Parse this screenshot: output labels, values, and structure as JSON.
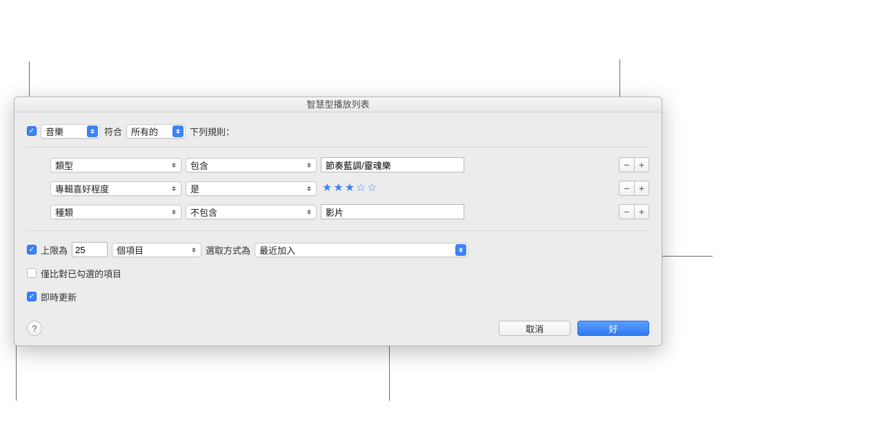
{
  "title": "智慧型播放列表",
  "match": {
    "media_label": "音樂",
    "conform_label": "符合",
    "quantifier": "所有的",
    "suffix": "下列規則："
  },
  "rules": [
    {
      "attribute": "類型",
      "operator": "包含",
      "value": "節奏藍調/靈魂樂",
      "input_type": "text"
    },
    {
      "attribute": "專輯喜好程度",
      "operator": "是",
      "stars_filled": 3,
      "stars_total": 5,
      "input_type": "stars"
    },
    {
      "attribute": "種類",
      "operator": "不包含",
      "value": "影片",
      "input_type": "text"
    }
  ],
  "limit": {
    "label": "上限為",
    "value": "25",
    "unit": "個項目",
    "select_label": "選取方式為",
    "select_value": "最近加入"
  },
  "options": {
    "only_checked_label": "僅比對已勾選的項目",
    "live_update_label": "即時更新"
  },
  "buttons": {
    "cancel": "取消",
    "ok": "好",
    "help": "?",
    "minus": "−",
    "plus": "+"
  }
}
